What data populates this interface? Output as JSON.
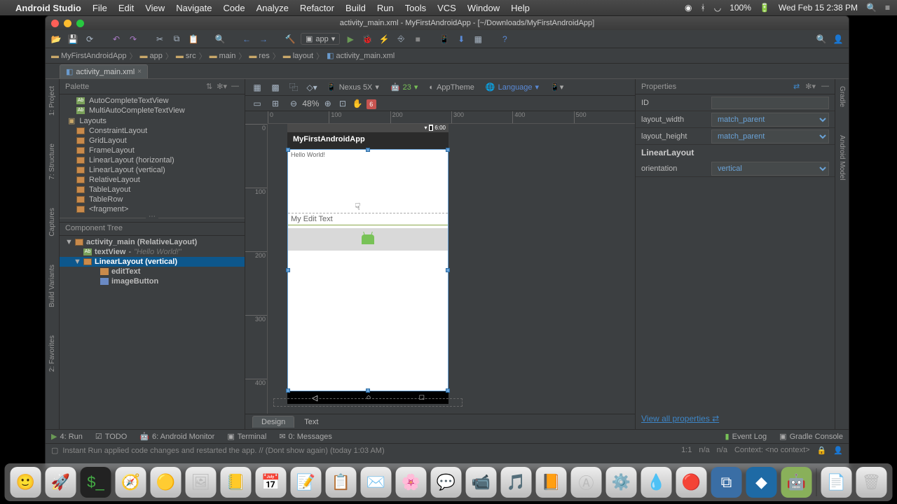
{
  "menubar": {
    "app": "Android Studio",
    "items": [
      "File",
      "Edit",
      "View",
      "Navigate",
      "Code",
      "Analyze",
      "Refactor",
      "Build",
      "Run",
      "Tools",
      "VCS",
      "Window",
      "Help"
    ],
    "battery": "100%",
    "clock": "Wed Feb 15  2:38 PM"
  },
  "window": {
    "title": "activity_main.xml - MyFirstAndroidApp - [~/Downloads/MyFirstAndroidApp]",
    "run_config": "app"
  },
  "breadcrumb": [
    "MyFirstAndroidApp",
    "app",
    "src",
    "main",
    "res",
    "layout",
    "activity_main.xml"
  ],
  "editor_tab": "activity_main.xml",
  "palette": {
    "title": "Palette",
    "items": [
      "AutoCompleteTextView",
      "MultiAutoCompleteTextView"
    ],
    "group": "Layouts",
    "layouts": [
      "ConstraintLayout",
      "GridLayout",
      "FrameLayout",
      "LinearLayout (horizontal)",
      "LinearLayout (vertical)",
      "RelativeLayout",
      "TableLayout",
      "TableRow",
      "<fragment>"
    ]
  },
  "tree": {
    "title": "Component Tree",
    "root": "activity_main (RelativeLayout)",
    "textview": "textView",
    "textview_hint": "\"Hello World!\"",
    "linear": "LinearLayout (vertical)",
    "edit": "editText",
    "imgbtn": "imageButton"
  },
  "designer": {
    "device": "Nexus 5X",
    "api": "23",
    "theme": "AppTheme",
    "lang": "Language",
    "zoom": "48%",
    "warnings": "6",
    "status_time": "6:00",
    "app_title": "MyFirstAndroidApp",
    "hello": "Hello World!",
    "edit_text": "My Edit Text",
    "tabs": {
      "design": "Design",
      "text": "Text"
    }
  },
  "props": {
    "title": "Properties",
    "id_label": "ID",
    "id_value": "",
    "width_label": "layout_width",
    "width_value": "match_parent",
    "height_label": "layout_height",
    "height_value": "match_parent",
    "section": "LinearLayout",
    "orient_label": "orientation",
    "orient_value": "vertical",
    "view_all": "View all properties"
  },
  "side": {
    "project": "1: Project",
    "structure": "7: Structure",
    "captures": "Captures",
    "variants": "Build Variants",
    "favorites": "2: Favorites",
    "gradle": "Gradle",
    "model": "Android Model"
  },
  "bottom": {
    "run": "4: Run",
    "todo": "TODO",
    "monitor": "6: Android Monitor",
    "terminal": "Terminal",
    "messages": "0: Messages",
    "eventlog": "Event Log",
    "gradlec": "Gradle Console"
  },
  "status": {
    "msg": "Instant Run applied code changes and restarted the app. // (Dont show again) (today 1:03 AM)",
    "pos": "1:1",
    "na1": "n/a",
    "na2": "n/a",
    "ctx": "Context: <no context>"
  }
}
